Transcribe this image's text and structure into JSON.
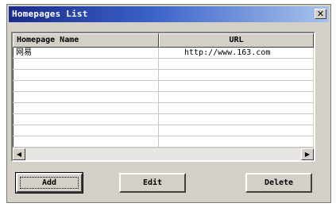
{
  "window": {
    "title": "Homepages List",
    "close_glyph": "✕"
  },
  "table": {
    "columns": [
      "Homepage Name",
      "URL"
    ],
    "rows": [
      {
        "name": "网易",
        "url": "http://www.163.com"
      },
      {
        "name": "",
        "url": ""
      },
      {
        "name": "",
        "url": ""
      },
      {
        "name": "",
        "url": ""
      },
      {
        "name": "",
        "url": ""
      },
      {
        "name": "",
        "url": ""
      },
      {
        "name": "",
        "url": ""
      },
      {
        "name": "",
        "url": ""
      },
      {
        "name": "",
        "url": ""
      }
    ]
  },
  "scrollbar": {
    "left_glyph": "◀",
    "right_glyph": "▶"
  },
  "buttons": {
    "add": "Add",
    "edit": "Edit",
    "delete": "Delete"
  }
}
